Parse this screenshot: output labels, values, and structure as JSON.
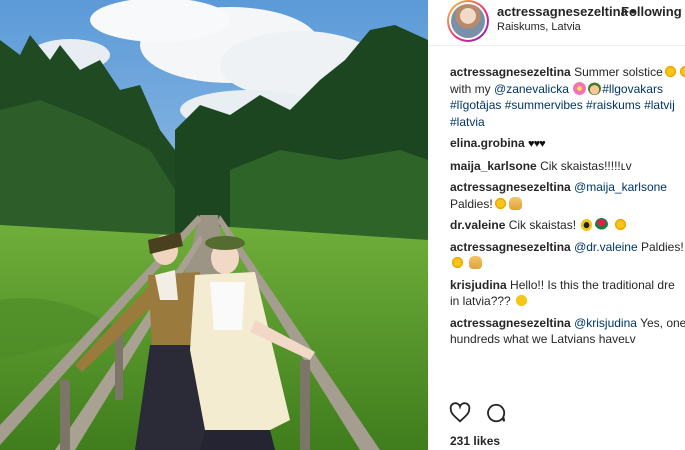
{
  "header": {
    "username": "actressagnesezeltina",
    "separator": "•",
    "follow_label": "Following",
    "location": "Raiskums, Latvia"
  },
  "comments": [
    {
      "user": "actressagnesezeltina",
      "line1_text": "Summer solstice",
      "line2_prefix": "with my",
      "line2_mention": "@zanevalicka",
      "line2_tag": "#llgovakars",
      "line3": "#līgotājas #summervibes #raiskums #latvij",
      "line4": "#latvia"
    },
    {
      "user": "elina.grobina",
      "hearts": "♥♥♥"
    },
    {
      "user": "maija_karlsone",
      "text": "Cik skaistas!!!!!ʟv"
    },
    {
      "user": "actressagnesezeltina",
      "mention": "@maija_karlsone",
      "line2_text": "Paldies!"
    },
    {
      "user": "dr.valeine",
      "text": "Cik skaistas!"
    },
    {
      "user": "actressagnesezeltina",
      "mention": "@dr.valeine",
      "text": "Paldies!"
    },
    {
      "user": "krisjudina",
      "text": "Hello!! Is this the traditional dre",
      "line2_text": "in latvia???"
    },
    {
      "user": "actressagnesezeltina",
      "mention": "@krisjudina",
      "text": "Yes, one",
      "line2_text": "hundreds what we Latvians haveʟv"
    }
  ],
  "actions": {
    "like_icon": "heart-outline-icon",
    "comment_icon": "comment-bubble-icon"
  },
  "likes_label": "231 likes",
  "colors": {
    "link": "#003569",
    "text": "#262626",
    "border": "#efefef"
  }
}
